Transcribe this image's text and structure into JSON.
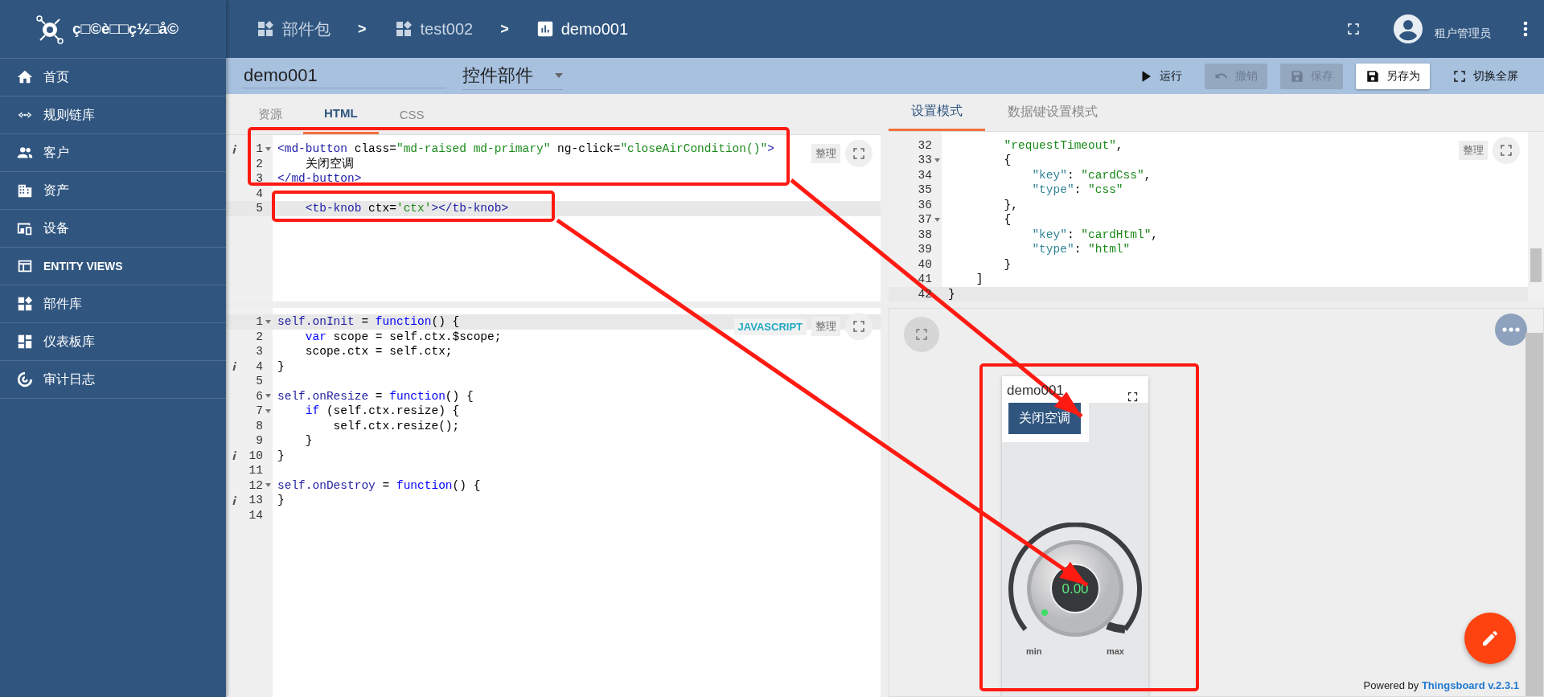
{
  "sidebar": {
    "logo_text": "ç□©è□□ç½□å©",
    "items": [
      {
        "label": "首页",
        "selected": false
      },
      {
        "label": "规则链库",
        "selected": false
      },
      {
        "label": "客户",
        "selected": false
      },
      {
        "label": "资产",
        "selected": false
      },
      {
        "label": "设备",
        "selected": false
      },
      {
        "label": "ENTITY VIEWS",
        "selected": false
      },
      {
        "label": "部件库",
        "selected": false
      },
      {
        "label": "仪表板库",
        "selected": false
      },
      {
        "label": "审计日志",
        "selected": false
      }
    ]
  },
  "breadcrumb": [
    {
      "label": "部件包"
    },
    {
      "label": "test002"
    },
    {
      "label": "demo001"
    }
  ],
  "breadcrumb_separator": ">",
  "user": {
    "name": "租户管理员"
  },
  "toolbar": {
    "title_value": "demo001",
    "type_value": "控件部件",
    "buttons": [
      {
        "label": "运行",
        "disabled": false,
        "raised": false
      },
      {
        "label": "撤销",
        "disabled": true,
        "raised": false
      },
      {
        "label": "保存",
        "disabled": true,
        "raised": false
      },
      {
        "label": "另存为",
        "disabled": false,
        "raised": true
      },
      {
        "label": "切换全屏",
        "disabled": false,
        "raised": false
      }
    ]
  },
  "html_editor": {
    "tabs": [
      {
        "label": "资源",
        "selected": false
      },
      {
        "label": "HTML",
        "selected": true
      },
      {
        "label": "CSS",
        "selected": false
      }
    ],
    "beautify": "整理",
    "lines": [
      {
        "number": "1",
        "fold": true,
        "info": true,
        "highlighted": false,
        "tokens": [
          {
            "text": "<md-button",
            "kind": "tag"
          },
          {
            "text": " class=",
            "kind": "plain"
          },
          {
            "text": "\"md-raised md-primary\"",
            "kind": "string"
          },
          {
            "text": " ng-click=",
            "kind": "plain"
          },
          {
            "text": "\"closeAirCondition()\"",
            "kind": "string"
          },
          {
            "text": ">",
            "kind": "tag"
          }
        ]
      },
      {
        "number": "2",
        "fold": false,
        "info": false,
        "highlighted": false,
        "tokens": [
          {
            "text": "    关闭空调",
            "kind": "plain"
          }
        ]
      },
      {
        "number": "3",
        "fold": false,
        "info": false,
        "highlighted": false,
        "tokens": [
          {
            "text": "</md-button>",
            "kind": "tag"
          }
        ]
      },
      {
        "number": "4",
        "fold": false,
        "info": false,
        "highlighted": false
      },
      {
        "number": "5",
        "fold": false,
        "info": false,
        "highlighted": true,
        "tokens": [
          {
            "text": "    <tb-knob",
            "kind": "tag"
          },
          {
            "text": " ctx=",
            "kind": "plain"
          },
          {
            "text": "'ctx'",
            "kind": "string"
          },
          {
            "text": "></tb-knob>",
            "kind": "tag"
          }
        ]
      }
    ]
  },
  "settings_editor": {
    "tabs": [
      {
        "label": "设置模式",
        "selected": true
      },
      {
        "label": "数据键设置模式",
        "selected": false
      }
    ],
    "beautify": "整理",
    "lines": [
      {
        "number": "32",
        "fold": false,
        "highlighted": false,
        "tokens": [
          {
            "text": "        \"requestTimeout\"",
            "kind": "string"
          },
          {
            "text": ",",
            "kind": "plain"
          }
        ]
      },
      {
        "number": "33",
        "fold": true,
        "highlighted": false,
        "tokens": [
          {
            "text": "        {",
            "kind": "plain"
          }
        ]
      },
      {
        "number": "34",
        "fold": false,
        "highlighted": false,
        "tokens": [
          {
            "text": "            \"key\"",
            "kind": "key"
          },
          {
            "text": ": ",
            "kind": "plain"
          },
          {
            "text": "\"cardCss\"",
            "kind": "string"
          },
          {
            "text": ",",
            "kind": "plain"
          }
        ]
      },
      {
        "number": "35",
        "fold": false,
        "highlighted": false,
        "tokens": [
          {
            "text": "            \"type\"",
            "kind": "key"
          },
          {
            "text": ": ",
            "kind": "plain"
          },
          {
            "text": "\"css\"",
            "kind": "string"
          }
        ]
      },
      {
        "number": "36",
        "fold": false,
        "highlighted": false,
        "tokens": [
          {
            "text": "        },",
            "kind": "plain"
          }
        ]
      },
      {
        "number": "37",
        "fold": true,
        "highlighted": false,
        "tokens": [
          {
            "text": "        {",
            "kind": "plain"
          }
        ]
      },
      {
        "number": "38",
        "fold": false,
        "highlighted": false,
        "tokens": [
          {
            "text": "            \"key\"",
            "kind": "key"
          },
          {
            "text": ": ",
            "kind": "plain"
          },
          {
            "text": "\"cardHtml\"",
            "kind": "string"
          },
          {
            "text": ",",
            "kind": "plain"
          }
        ]
      },
      {
        "number": "39",
        "fold": false,
        "highlighted": false,
        "tokens": [
          {
            "text": "            \"type\"",
            "kind": "key"
          },
          {
            "text": ": ",
            "kind": "plain"
          },
          {
            "text": "\"html\"",
            "kind": "string"
          }
        ]
      },
      {
        "number": "40",
        "fold": false,
        "highlighted": false,
        "tokens": [
          {
            "text": "        }",
            "kind": "plain"
          }
        ]
      },
      {
        "number": "41",
        "fold": false,
        "highlighted": false,
        "tokens": [
          {
            "text": "    ]",
            "kind": "plain"
          }
        ]
      },
      {
        "number": "42",
        "fold": false,
        "highlighted": true,
        "tokens": [
          {
            "text": "}",
            "kind": "plain"
          }
        ]
      }
    ]
  },
  "js_editor": {
    "mode_label": "JAVASCRIPT",
    "beautify": "整理",
    "lines": [
      {
        "number": "1",
        "fold": true,
        "info": false,
        "highlighted": true,
        "tokens": [
          {
            "text": "self.onInit",
            "kind": "name"
          },
          {
            "text": " = ",
            "kind": "plain"
          },
          {
            "text": "function",
            "kind": "keyword"
          },
          {
            "text": "() {",
            "kind": "plain"
          }
        ]
      },
      {
        "number": "2",
        "fold": false,
        "info": false,
        "highlighted": false,
        "tokens": [
          {
            "text": "    var",
            "kind": "keyword"
          },
          {
            "text": " scope = self.ctx.$scope;",
            "kind": "plain"
          }
        ]
      },
      {
        "number": "3",
        "fold": false,
        "info": false,
        "highlighted": false,
        "tokens": [
          {
            "text": "    scope.ctx = self.ctx;",
            "kind": "plain"
          }
        ]
      },
      {
        "number": "4",
        "fold": false,
        "info": true,
        "highlighted": false,
        "tokens": [
          {
            "text": "}",
            "kind": "plain"
          }
        ]
      },
      {
        "number": "5",
        "fold": false,
        "info": false,
        "highlighted": false
      },
      {
        "number": "6",
        "fold": true,
        "info": false,
        "highlighted": false,
        "tokens": [
          {
            "text": "self.onResize",
            "kind": "name"
          },
          {
            "text": " = ",
            "kind": "plain"
          },
          {
            "text": "function",
            "kind": "keyword"
          },
          {
            "text": "() {",
            "kind": "plain"
          }
        ]
      },
      {
        "number": "7",
        "fold": true,
        "info": false,
        "highlighted": false,
        "tokens": [
          {
            "text": "    if",
            "kind": "keyword"
          },
          {
            "text": " (self.ctx.resize) {",
            "kind": "plain"
          }
        ]
      },
      {
        "number": "8",
        "fold": false,
        "info": false,
        "highlighted": false,
        "tokens": [
          {
            "text": "        self.ctx.resize();",
            "kind": "plain"
          }
        ]
      },
      {
        "number": "9",
        "fold": false,
        "info": false,
        "highlighted": false,
        "tokens": [
          {
            "text": "    }",
            "kind": "plain"
          }
        ]
      },
      {
        "number": "10",
        "fold": false,
        "info": true,
        "highlighted": false,
        "tokens": [
          {
            "text": "}",
            "kind": "plain"
          }
        ]
      },
      {
        "number": "11",
        "fold": false,
        "info": false,
        "highlighted": false
      },
      {
        "number": "12",
        "fold": true,
        "info": false,
        "highlighted": false,
        "tokens": [
          {
            "text": "self.onDestroy",
            "kind": "name"
          },
          {
            "text": " = ",
            "kind": "plain"
          },
          {
            "text": "function",
            "kind": "keyword"
          },
          {
            "text": "() {",
            "kind": "plain"
          }
        ]
      },
      {
        "number": "13",
        "fold": false,
        "info": true,
        "highlighted": false,
        "tokens": [
          {
            "text": "}",
            "kind": "plain"
          }
        ]
      },
      {
        "number": "14",
        "fold": false,
        "info": false,
        "highlighted": false
      }
    ]
  },
  "preview": {
    "widget": {
      "title": "demo001",
      "button": "关闭空调",
      "knob_value": "0.00",
      "min_label": "min",
      "max_label": "max"
    },
    "footer": {
      "prefix": "Powered by",
      "link": "Thingsboard v.2.3.1"
    }
  },
  "annotations": [
    {
      "kind": "box"
    },
    {
      "kind": "box"
    },
    {
      "kind": "box"
    },
    {
      "kind": "arrow"
    },
    {
      "kind": "arrow"
    }
  ]
}
